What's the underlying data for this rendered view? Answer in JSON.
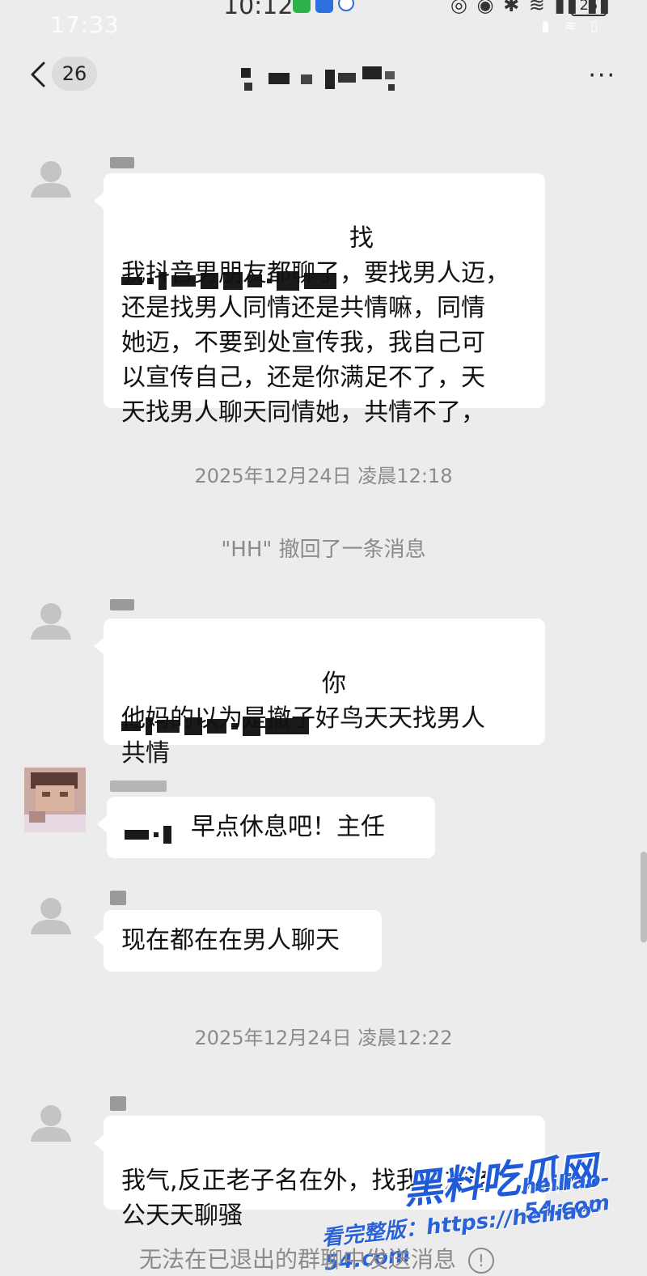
{
  "status_bar": {
    "time_overlay": "17:33",
    "time": "10:12",
    "battery": "25",
    "colors": {
      "wechat_green": "#2bb34a",
      "blue": "#2d6fe0"
    }
  },
  "nav": {
    "back_icon": "chevron-left-icon",
    "unread_count": "26",
    "more_icon": "more-icon",
    "more_label": "···"
  },
  "messages": [
    {
      "text": "找\n我抖音男朋友都聊了，要找男人迈，\n还是找男人同情还是共情嘛，同情\n她迈，不要到处宣传我，我自己可\n以宣传自己，还是你满足不了，天\n天找男人聊天同情她，共情不了，",
      "avatar": "default-avatar"
    },
    {
      "text": "你\n他妈的以为是撤子好鸟天天找男人\n共情",
      "avatar": "default-avatar"
    },
    {
      "text": "早点休息吧！主任",
      "avatar": "photo-avatar"
    },
    {
      "text": "现在都在在男人聊天",
      "avatar": "default-avatar"
    },
    {
      "text": "我气,反正老子名在外，找我朋友老\n公天天聊骚",
      "avatar": "default-avatar"
    }
  ],
  "system": {
    "timestamp_1": "2025年12月24日 凌晨12:18",
    "recall_notice": "\"HH\" 撤回了一条消息",
    "timestamp_2": "2025年12月24日 凌晨12:22"
  },
  "watermark": {
    "logo": "黑料吃瓜网",
    "domain": "heiliao-54.com",
    "caption": "看完整版：https://heiliao-54.com"
  },
  "footer": {
    "notice": "无法在已退出的群聊中发送消息",
    "info_icon": "info-icon"
  }
}
